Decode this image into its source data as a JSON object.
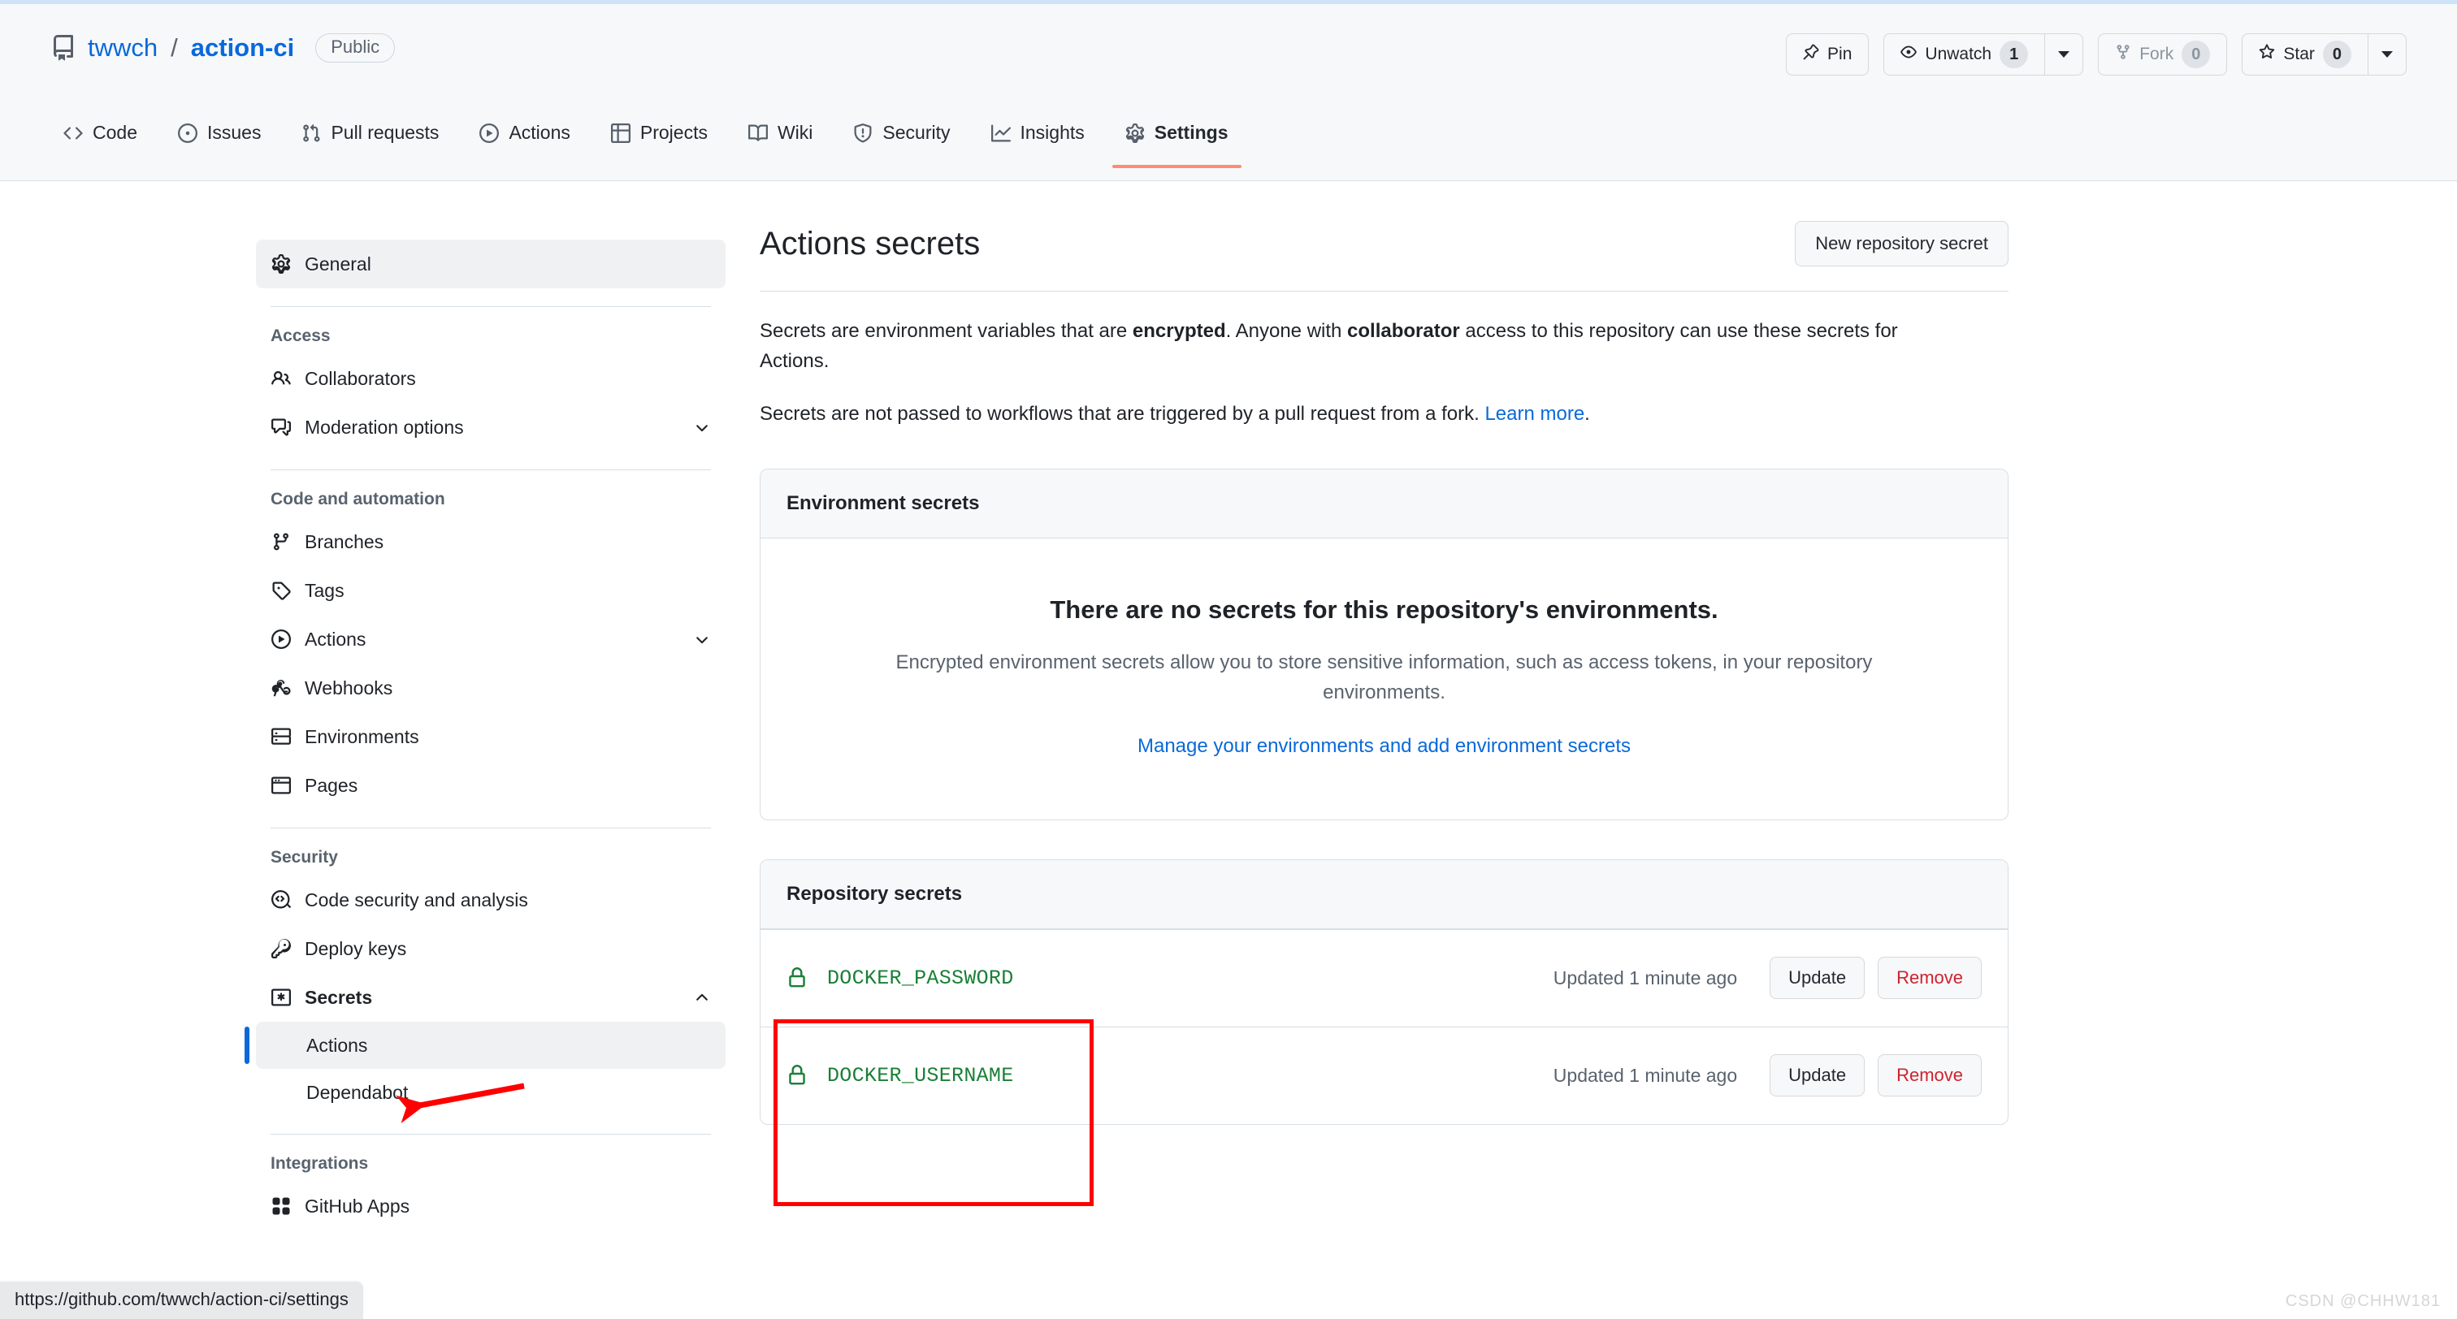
{
  "repo": {
    "icon": "repo-icon",
    "owner": "twwch",
    "separator": "/",
    "name": "action-ci",
    "visibility": "Public"
  },
  "header_actions": {
    "pin": {
      "label": "Pin",
      "icon": "pin-icon"
    },
    "unwatch": {
      "label": "Unwatch",
      "count": "1",
      "icon": "eye-icon"
    },
    "fork": {
      "label": "Fork",
      "count": "0",
      "icon": "fork-icon",
      "disabled": true
    },
    "star": {
      "label": "Star",
      "count": "0",
      "icon": "star-icon"
    }
  },
  "nav_tabs": [
    {
      "label": "Code",
      "icon": "code-icon",
      "active": false
    },
    {
      "label": "Issues",
      "icon": "issue-opened-icon",
      "active": false
    },
    {
      "label": "Pull requests",
      "icon": "git-pull-request-icon",
      "active": false
    },
    {
      "label": "Actions",
      "icon": "play-icon",
      "active": false
    },
    {
      "label": "Projects",
      "icon": "table-icon",
      "active": false
    },
    {
      "label": "Wiki",
      "icon": "book-icon",
      "active": false
    },
    {
      "label": "Security",
      "icon": "shield-icon",
      "active": false
    },
    {
      "label": "Insights",
      "icon": "graph-icon",
      "active": false
    },
    {
      "label": "Settings",
      "icon": "gear-icon",
      "active": true
    }
  ],
  "sidebar": {
    "general": {
      "label": "General",
      "icon": "gear-icon"
    },
    "groups": [
      {
        "title": "Access",
        "items": [
          {
            "label": "Collaborators",
            "icon": "people-icon",
            "expandable": false
          },
          {
            "label": "Moderation options",
            "icon": "comment-discussion-icon",
            "expandable": true,
            "expanded": false
          }
        ]
      },
      {
        "title": "Code and automation",
        "items": [
          {
            "label": "Branches",
            "icon": "git-branch-icon",
            "expandable": false
          },
          {
            "label": "Tags",
            "icon": "tag-icon",
            "expandable": false
          },
          {
            "label": "Actions",
            "icon": "play-icon",
            "expandable": true,
            "expanded": false
          },
          {
            "label": "Webhooks",
            "icon": "webhook-icon",
            "expandable": false
          },
          {
            "label": "Environments",
            "icon": "server-icon",
            "expandable": false
          },
          {
            "label": "Pages",
            "icon": "browser-icon",
            "expandable": false
          }
        ]
      },
      {
        "title": "Security",
        "items": [
          {
            "label": "Code security and analysis",
            "icon": "codescan-icon",
            "expandable": false
          },
          {
            "label": "Deploy keys",
            "icon": "key-icon",
            "expandable": false
          },
          {
            "label": "Secrets",
            "icon": "asterisk-icon",
            "expandable": true,
            "expanded": true,
            "selected_parent": true
          }
        ],
        "sub_items": [
          {
            "label": "Actions",
            "selected": true
          },
          {
            "label": "Dependabot",
            "selected": false
          }
        ]
      },
      {
        "title": "Integrations",
        "items": [
          {
            "label": "GitHub Apps",
            "icon": "apps-icon",
            "expandable": false
          }
        ]
      }
    ]
  },
  "main": {
    "title": "Actions secrets",
    "new_secret_button": "New repository secret",
    "description_1": {
      "part1": "Secrets are environment variables that are ",
      "bold1": "encrypted",
      "part2": ". Anyone with ",
      "bold2": "collaborator",
      "part3": " access to this repository can use these secrets for Actions."
    },
    "description_2": {
      "text": "Secrets are not passed to workflows that are triggered by a pull request from a fork. ",
      "link": "Learn more",
      "tail": "."
    },
    "environment_panel": {
      "heading": "Environment secrets",
      "blank_title": "There are no secrets for this repository's environments.",
      "blank_body": "Encrypted environment secrets allow you to store sensitive information, such as access tokens, in your repository environments.",
      "manage_link": "Manage your environments and add environment secrets"
    },
    "repository_panel": {
      "heading": "Repository secrets",
      "rows": [
        {
          "name": "DOCKER_PASSWORD",
          "icon": "lock-icon",
          "updated": "Updated 1 minute ago",
          "update_label": "Update",
          "remove_label": "Remove"
        },
        {
          "name": "DOCKER_USERNAME",
          "icon": "lock-icon",
          "updated": "Updated 1 minute ago",
          "update_label": "Update",
          "remove_label": "Remove"
        }
      ]
    }
  },
  "annotations": {
    "box_color": "#ff0000",
    "arrow_color": "#ff0000",
    "arrow_target": "sidebar-sub-actions"
  },
  "status_bar": {
    "url": "https://github.com/twwch/action-ci/settings"
  },
  "watermark": {
    "text": "CSDN @CHHW181"
  },
  "colors": {
    "accent_blue": "#0969da",
    "active_tab_underline": "#fd8c73",
    "secret_green": "#1a7f37",
    "danger_red": "#cf222e",
    "header_bg": "#f6f8fa",
    "border": "#d8dee4"
  }
}
